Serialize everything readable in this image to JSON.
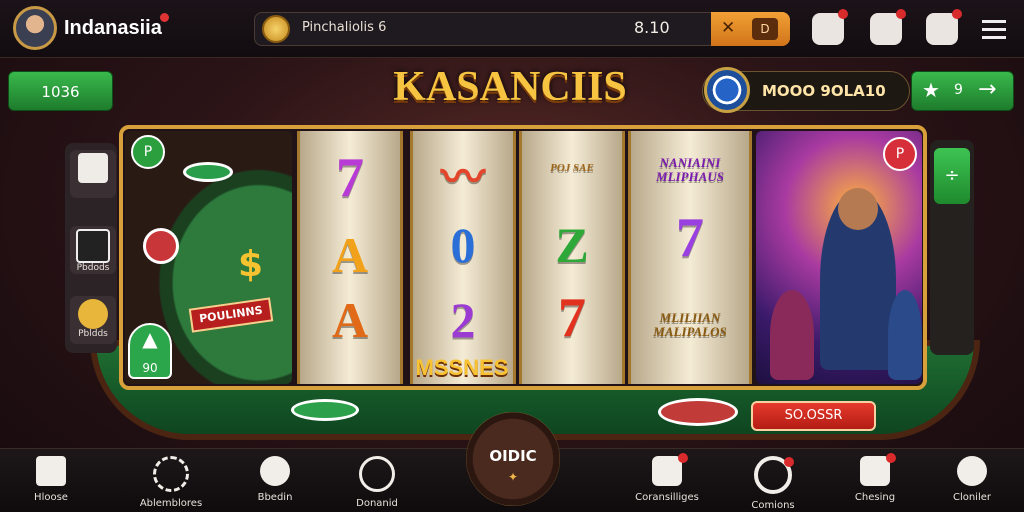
{
  "header": {
    "brand_name": "Indanasiia",
    "balance_label": "Pinchaliolis 6",
    "balance_amount": "8.10",
    "buy_symbol": "✕",
    "buy_box_label": "D"
  },
  "title_row": {
    "left_button_label": "1036",
    "game_title": "KASANCIIS",
    "mode_label": "MOOO 9OLA10",
    "right_button_count": "9"
  },
  "left_menu": [
    {
      "label": ""
    },
    {
      "label": "Pbdods"
    },
    {
      "label": "Pbldds"
    }
  ],
  "right_menu": {
    "button_label": "÷"
  },
  "slot": {
    "reel_banner": "MSSNES",
    "promo_tag": "POULINNS",
    "left_badge_top": "P",
    "left_badge_bottom_count": "90",
    "right_badge_top": "P",
    "reels": [
      {
        "symbols": [
          "7",
          "A",
          "A"
        ],
        "colors": [
          "#b83bd6",
          "#f2a21a",
          "#e06a17"
        ]
      },
      {
        "symbols": [
          "〰",
          "0",
          "2"
        ],
        "colors": [
          "#e3462b",
          "#2a6fd8",
          "#9c3bd1"
        ]
      },
      {
        "symbols": [
          "POJ SAE",
          "Z",
          "7"
        ],
        "colors": [
          "#a0661a",
          "#2fa83a",
          "#e0321f"
        ]
      },
      {
        "symbols": [
          "NANIAINI MLIPHAUS",
          "7",
          "MLILIIAN MALIPALOS"
        ],
        "colors": [
          "#7a1bb0",
          "#9a3fe0",
          "#8a5a10"
        ]
      }
    ]
  },
  "table": {
    "bet_button_label": "SO.OSSR"
  },
  "spin": {
    "label": "OIDIC",
    "star": "✦"
  },
  "bottom_nav": [
    {
      "label": "Hloose",
      "icon": "home-icon"
    },
    {
      "label": "Ablemblores",
      "icon": "refresh-icon"
    },
    {
      "label": "Bbedin",
      "icon": "coin-icon"
    },
    {
      "label": "Donanid",
      "icon": "user-icon"
    },
    {
      "label": "Coransilliges",
      "icon": "rocket-icon"
    },
    {
      "label": "Comions",
      "icon": "search-icon"
    },
    {
      "label": "Chesing",
      "icon": "chat-icon"
    },
    {
      "label": "Cloniler",
      "icon": "settings-icon"
    }
  ],
  "colors": {
    "gold": "#d7a03a",
    "green": "#2ca64a",
    "red": "#d92b2b"
  }
}
